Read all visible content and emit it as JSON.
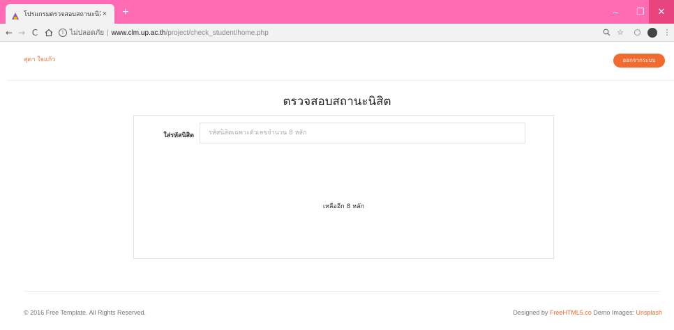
{
  "browser": {
    "tab_title": "โปรแกรมตรวจสอบสถานะนิสิต",
    "tab_close": "×",
    "new_tab": "+",
    "url": {
      "security": "ไม่ปลอดภัย",
      "separator": "|",
      "host": "www.clm.up.ac.th",
      "path": "/project/check_student/home.php"
    },
    "window_controls": {
      "minimize": "–",
      "maximize": "❐",
      "close": "✕"
    },
    "icons": [
      "back-icon",
      "forward-icon",
      "reload-icon",
      "home-icon",
      "info-icon",
      "zoom-icon",
      "star-icon",
      "extension-icon",
      "avatar-icon",
      "menu-icon"
    ]
  },
  "header": {
    "user_name": "สุดา ใจแก้ว",
    "logout_label": "ออกจากระบบ"
  },
  "main": {
    "title": "ตรวจสอบสถานะนิสิต",
    "field_label": "ใส่รหัสนิสิต",
    "field_value": "",
    "field_placeholder": "รหัสนิสิตเฉพาะตัวเลขจำนวน 8 หลัก",
    "remaining_text": "เหลืออีก 8 หลัก"
  },
  "footer": {
    "copyright": "© 2016 Free Template. All Rights Reserved.",
    "designed_by": "Designed by",
    "designer_link": "FreeHTML5.co",
    "demo_images": "Demo Images:",
    "images_link": "Unsplash"
  },
  "colors": {
    "tabbar": "#ff6ab4",
    "accent": "#f36a2e"
  }
}
